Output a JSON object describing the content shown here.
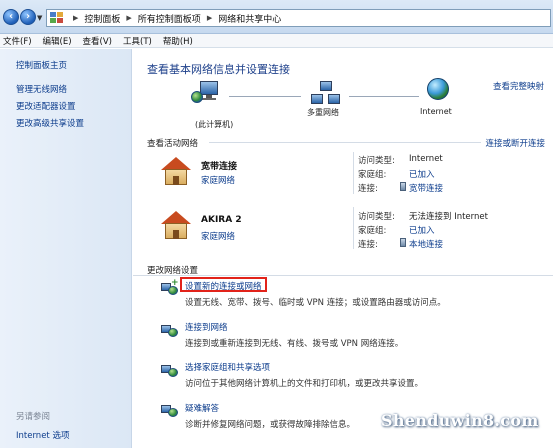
{
  "breadcrumb": {
    "items": [
      "控制面板",
      "所有控制面板项",
      "网络和共享中心"
    ]
  },
  "menu": {
    "items": [
      "文件(F)",
      "编辑(E)",
      "查看(V)",
      "工具(T)",
      "帮助(H)"
    ]
  },
  "left_pane": {
    "home": "控制面板主页",
    "links": [
      "管理无线网络",
      "更改适配器设置",
      "更改高级共享设置"
    ],
    "see_also_title": "另请参阅",
    "see_also_links": [
      "Internet 选项"
    ]
  },
  "main": {
    "title": "查看基本网络信息并设置连接",
    "full_map_link": "查看完整映射",
    "map": {
      "computer_label": "(此计算机)",
      "multi_label": "多重网络",
      "internet_label": "Internet"
    },
    "active_header": "查看活动网络",
    "change_connection_link": "连接或断开连接",
    "networks": [
      {
        "name": "宽带连接",
        "type": "家庭网络",
        "access_label": "访问类型:",
        "access_value": "Internet",
        "homegroup_label": "家庭组:",
        "homegroup_value": "已加入",
        "connection_label": "连接:",
        "connection_value": "宽带连接"
      },
      {
        "name": "AKIRA  2",
        "type": "家庭网络",
        "access_label": "访问类型:",
        "access_value": "无法连接到 Internet",
        "homegroup_label": "家庭组:",
        "homegroup_value": "已加入",
        "connection_label": "连接:",
        "connection_value": "本地连接"
      }
    ],
    "change_header": "更改网络设置",
    "tasks": [
      {
        "link": "设置新的连接或网络",
        "desc": "设置无线、宽带、拨号、临时或 VPN 连接；或设置路由器或访问点。"
      },
      {
        "link": "连接到网络",
        "desc": "连接到或重新连接到无线、有线、拨号或 VPN 网络连接。"
      },
      {
        "link": "选择家庭组和共享选项",
        "desc": "访问位于其他网络计算机上的文件和打印机，或更改共享设置。"
      },
      {
        "link": "疑难解答",
        "desc": "诊断并修复网络问题，或获得故障排除信息。"
      }
    ]
  },
  "watermark": "Shenduwin8.com",
  "colors": {
    "link": "#0c3c8c",
    "title": "#1c3f8a",
    "highlight_box": "#e2231a"
  }
}
